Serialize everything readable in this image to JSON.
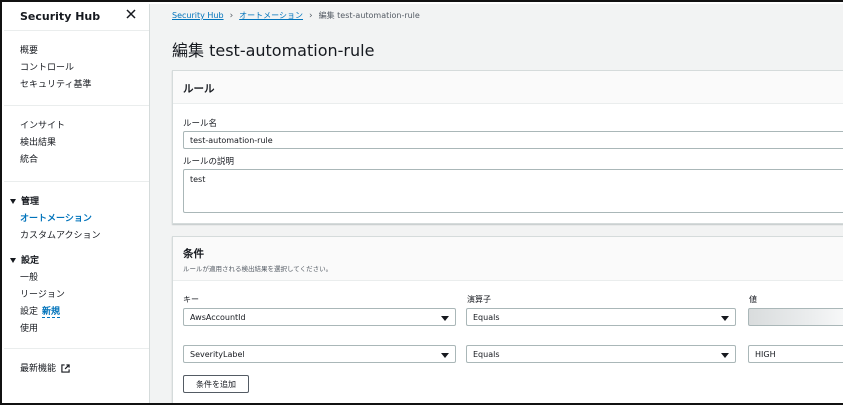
{
  "sidebar": {
    "title": "Security Hub",
    "group1": [
      "概要",
      "コントロール",
      "セキュリティ基準"
    ],
    "group2": [
      "インサイト",
      "検出結果",
      "統合"
    ],
    "manage": {
      "label": "管理",
      "items": [
        "オートメーション",
        "カスタムアクション"
      ]
    },
    "settings": {
      "label": "設定",
      "items": [
        "一般",
        "リージョン"
      ],
      "config_label": "設定",
      "new_label": "新規",
      "usage": "使用"
    },
    "whats_new": "最新機能"
  },
  "breadcrumb": {
    "item1": "Security Hub",
    "item2": "オートメーション",
    "current": "編集 test-automation-rule"
  },
  "page_title": "編集 test-automation-rule",
  "rule_panel": {
    "header": "ルール",
    "name_label": "ルール名",
    "name_value": "test-automation-rule",
    "desc_label": "ルールの説明",
    "desc_value": "test"
  },
  "criteria_panel": {
    "header": "条件",
    "description": "ルールが適用される検出結果を選択してください。",
    "col_key": "キー",
    "col_operator": "演算子",
    "col_value": "値",
    "rows": [
      {
        "key": "AwsAccountId",
        "operator": "Equals",
        "value": ""
      },
      {
        "key": "SeverityLabel",
        "operator": "Equals",
        "value": "HIGH"
      }
    ],
    "add_button": "条件を追加"
  }
}
